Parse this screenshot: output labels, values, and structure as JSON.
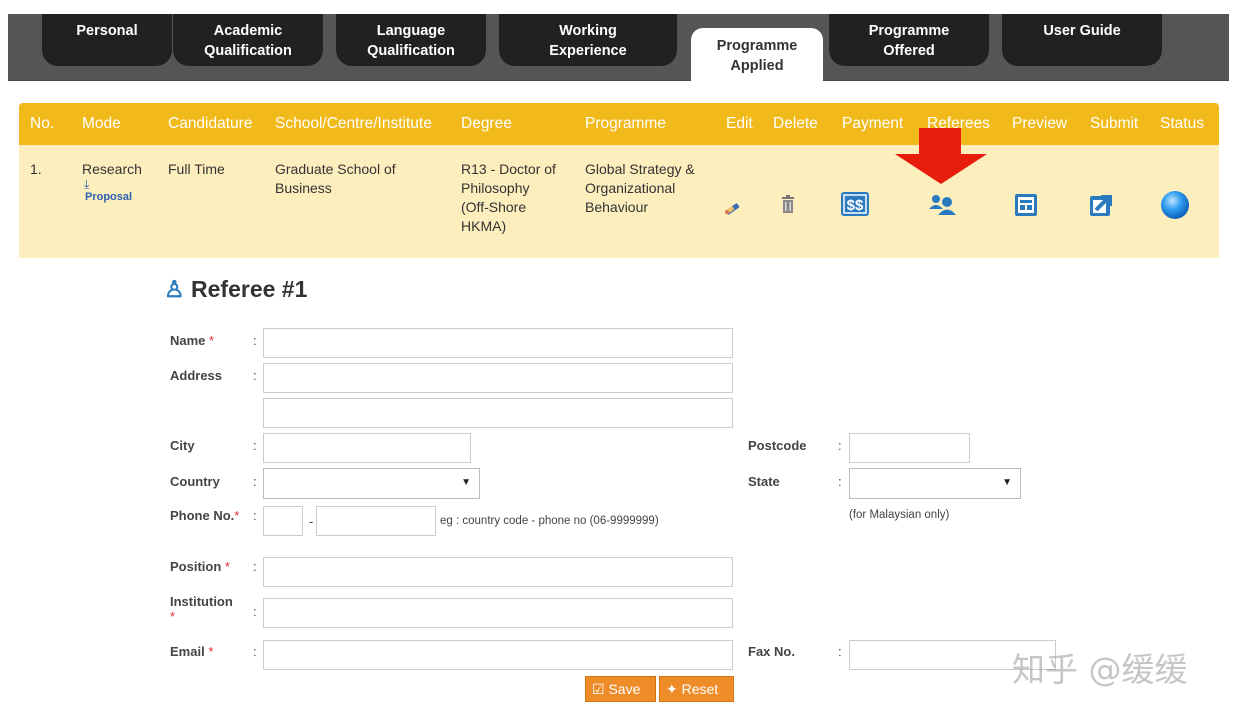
{
  "tabs": [
    {
      "label_lines": [
        "Personal"
      ]
    },
    {
      "label_lines": [
        "Academic",
        "Qualification"
      ]
    },
    {
      "label_lines": [
        "Language",
        "Qualification"
      ]
    },
    {
      "label_lines": [
        "Working",
        "Experience"
      ]
    },
    {
      "label_lines": [
        "Programme",
        "Applied"
      ],
      "active": true
    },
    {
      "label_lines": [
        "Programme",
        "Offered"
      ]
    },
    {
      "label_lines": [
        "User Guide"
      ]
    }
  ],
  "table": {
    "headers": [
      "No.",
      "Mode",
      "Candidature",
      "School/Centre/Institute",
      "Degree",
      "Programme",
      "Edit",
      "Delete",
      "Payment",
      "Referees",
      "Preview",
      "Submit",
      "Status"
    ],
    "row": {
      "no": "1.",
      "mode": "Research",
      "proposal_link": "Proposal",
      "candidature": "Full Time",
      "school_lines": [
        "Graduate School of",
        "Business"
      ],
      "degree_lines": [
        "R13 - Doctor of",
        "Philosophy",
        "(Off-Shore",
        "HKMA)"
      ],
      "programme_lines": [
        "Global Strategy &",
        "Organizational",
        "Behaviour"
      ]
    },
    "icons": [
      "edit-icon",
      "delete-icon",
      "payment-icon",
      "referees-icon",
      "preview-icon",
      "submit-icon",
      "status-icon"
    ],
    "colors": {
      "header": "#f2b91b",
      "row": "#fdeebe",
      "accent_arrow": "#e81c0c"
    }
  },
  "referee": {
    "title": "Referee #1",
    "labels": {
      "name": "Name",
      "address": "Address",
      "city": "City",
      "country": "Country",
      "phone": "Phone No.",
      "position": "Position",
      "institution": "Institution",
      "email": "Email",
      "postcode": "Postcode",
      "state": "State",
      "fax": "Fax No."
    },
    "required_mark": "*",
    "colon": ":",
    "phone_dash": "-",
    "phone_hint": "eg : country code - phone no (06-9999999)",
    "state_hint": "(for Malaysian only)",
    "buttons": {
      "save": "Save",
      "reset": "Reset"
    }
  },
  "watermark": "知乎 @缓缓"
}
